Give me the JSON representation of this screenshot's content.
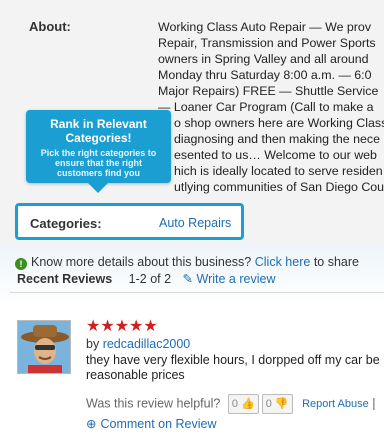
{
  "about": {
    "label": "About:",
    "lines": [
      "Working Class Auto Repair — We prov",
      "Repair, Transmission and Power Sports",
      "owners in Spring Valley and all around",
      "Monday thru Saturday 8:00 a.m. — 6:0",
      "Major Repairs) FREE — Shuttle Service",
      "— Loaner Car Program (Call to make a",
      "o shop owners here are Working Class",
      "diagnosing and then making the nece",
      "esented to us… Welcome to our web",
      "hich is ideally located to serve residen",
      "utlying communities of San Diego Cou"
    ]
  },
  "tooltip": {
    "title": "Rank in Relevant Categories!",
    "body": "Pick the right categories to ensure that the right customers find you"
  },
  "categories": {
    "label": "Categories:",
    "value": "Auto Repairs"
  },
  "know_more": {
    "text": "Know more details about this business?",
    "link": "Click here",
    "suffix": "to share"
  },
  "reviews": {
    "title": "Recent Reviews",
    "count": "1-2 of 2",
    "write_link": "Write a review",
    "items": [
      {
        "rating": 5,
        "by_prefix": "by",
        "author": "redcadillac2000",
        "line1": "they have very flexible hours, I dorpped off my car be",
        "line2": "reasonable prices",
        "helpful_label": "Was this review helpful?",
        "up_count": "0",
        "down_count": "0",
        "report": "Report Abuse",
        "separator": "|",
        "comment": "Comment on Review"
      }
    ]
  },
  "colors": {
    "accent": "#1b9ed2",
    "link": "#1d6db5",
    "star": "#d01f1f"
  }
}
